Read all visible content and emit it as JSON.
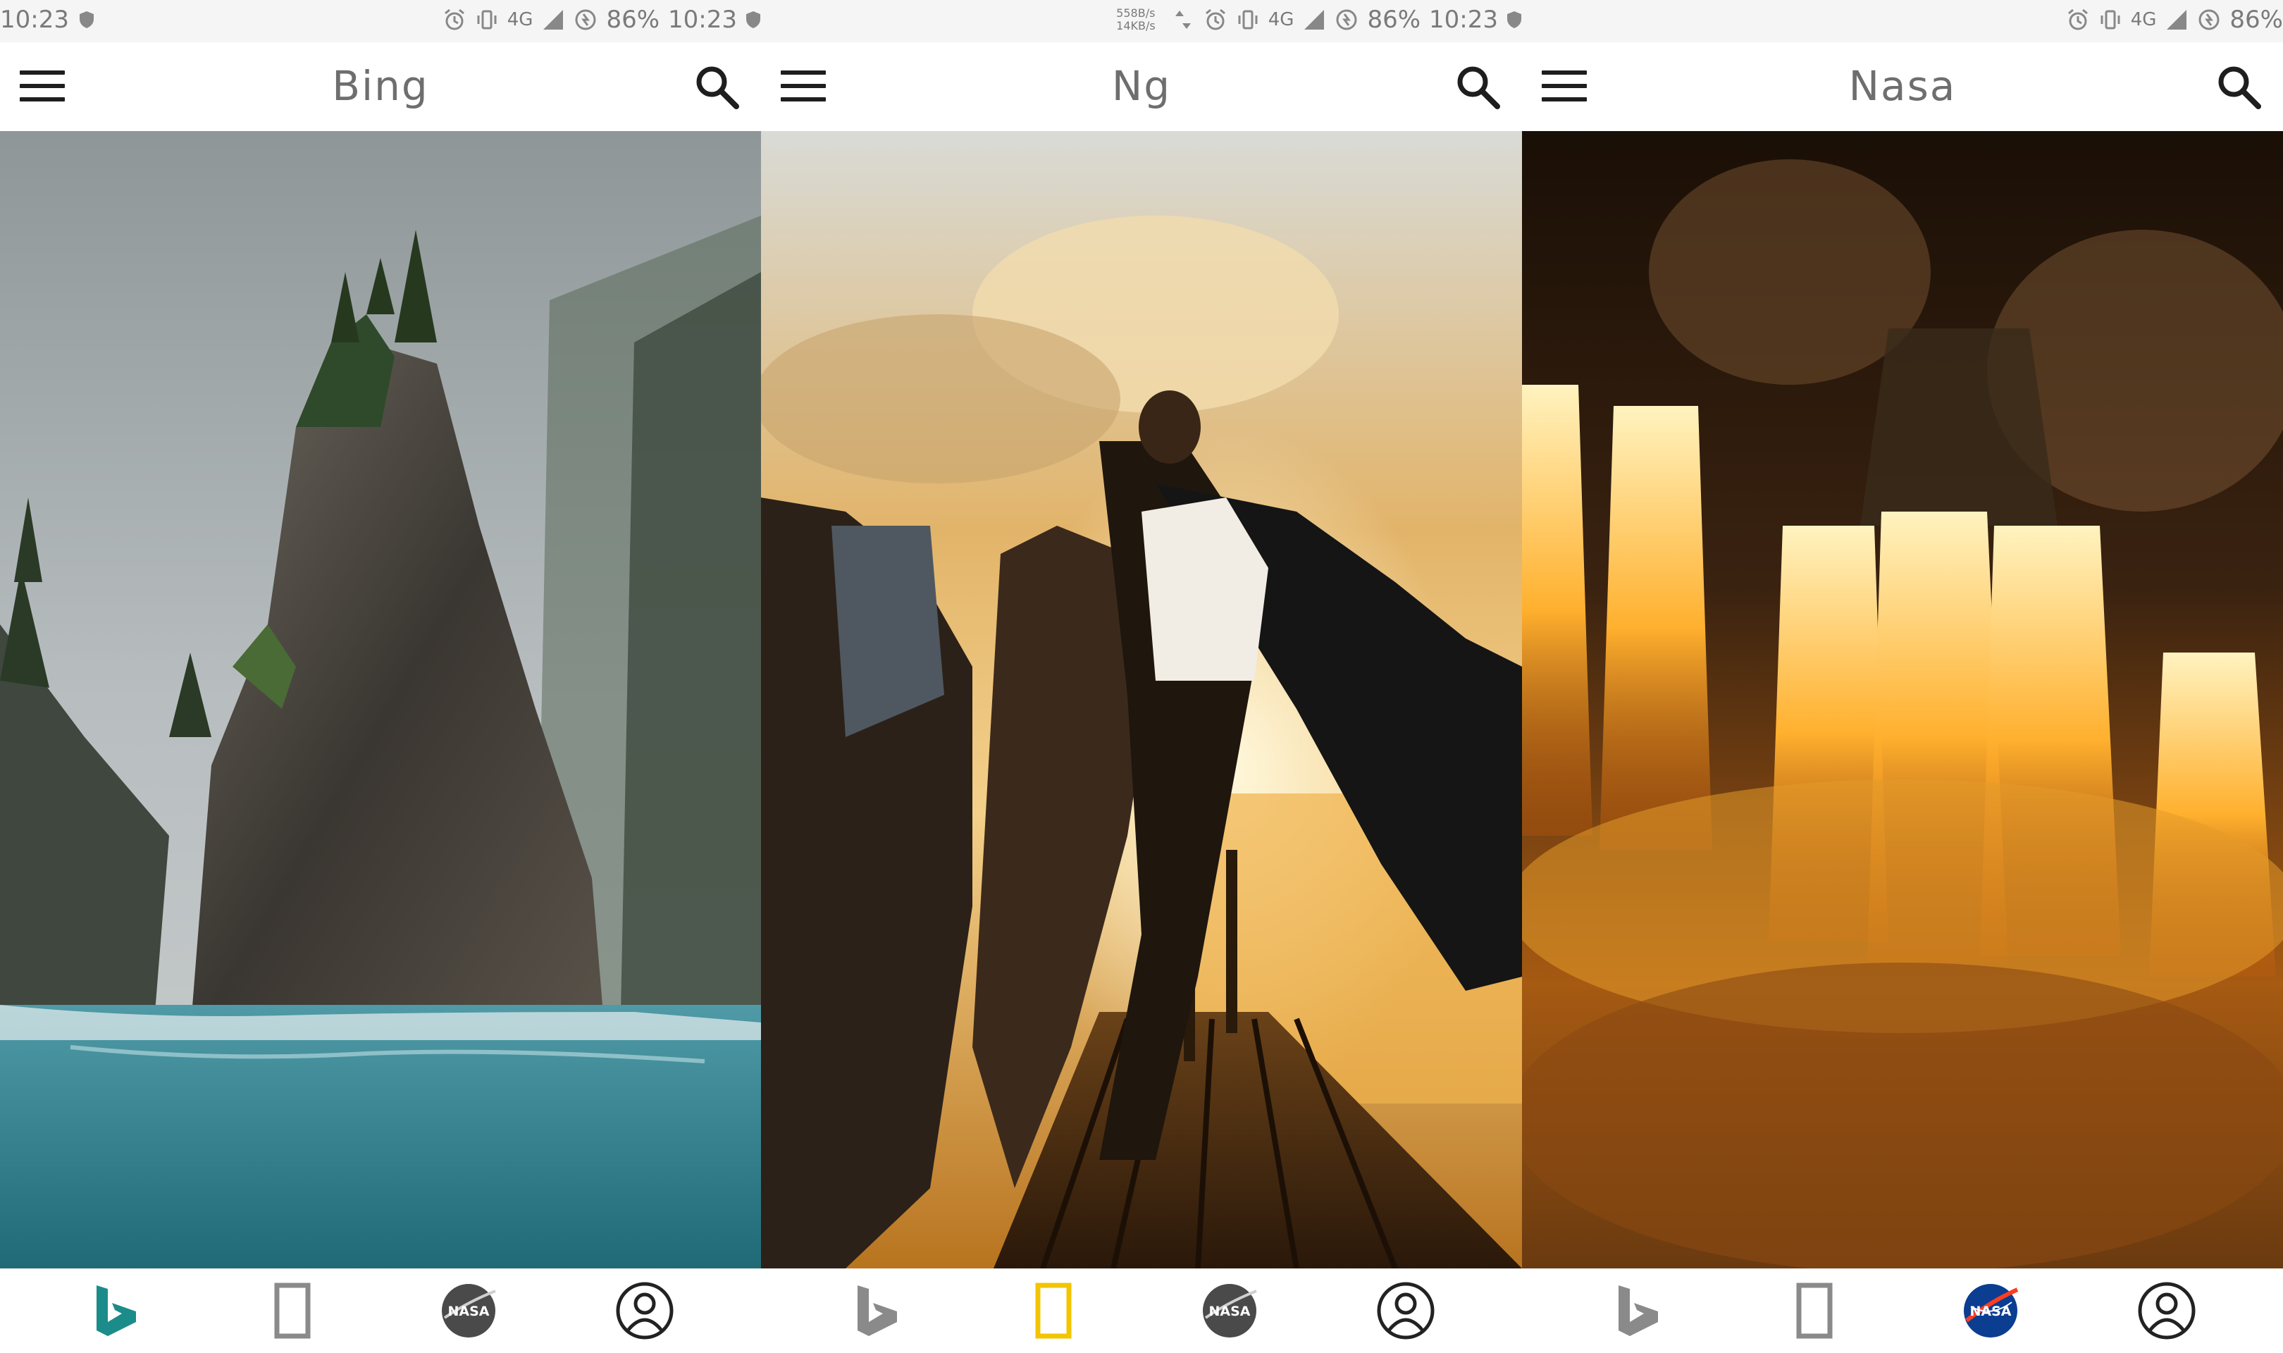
{
  "screens": [
    {
      "status": {
        "time_left": "10:23",
        "battery_right": "86%",
        "time_right": "10:23",
        "network": "4G"
      },
      "title": "Bing",
      "nav": {
        "active": "bing"
      },
      "photo_desc": "misty sea stack"
    },
    {
      "status": {
        "speed_up": "558B/s",
        "speed_down": "14KB/s",
        "network": "4G",
        "battery_right": "86%",
        "time_right": "10:23"
      },
      "title": "Ng",
      "nav": {
        "active": "ng"
      },
      "photo_desc": "sunset pier"
    },
    {
      "status": {
        "network": "4G",
        "battery_right": "86%"
      },
      "title": "Nasa",
      "nav": {
        "active": "nasa"
      },
      "photo_desc": "rocket engines"
    }
  ],
  "nasa_logo_text": "NASA",
  "colors": {
    "bing_active": "#1c8c8a",
    "inactive": "#8a8a8a",
    "ng_active": "#f2c500",
    "nasa_blue": "#0b3d91",
    "nasa_red": "#fc3d21",
    "statusbar_bg": "#f5f5f5"
  },
  "icons": [
    "menu-icon",
    "search-icon",
    "bing-icon",
    "natgeo-icon",
    "nasa-icon",
    "profile-icon"
  ]
}
